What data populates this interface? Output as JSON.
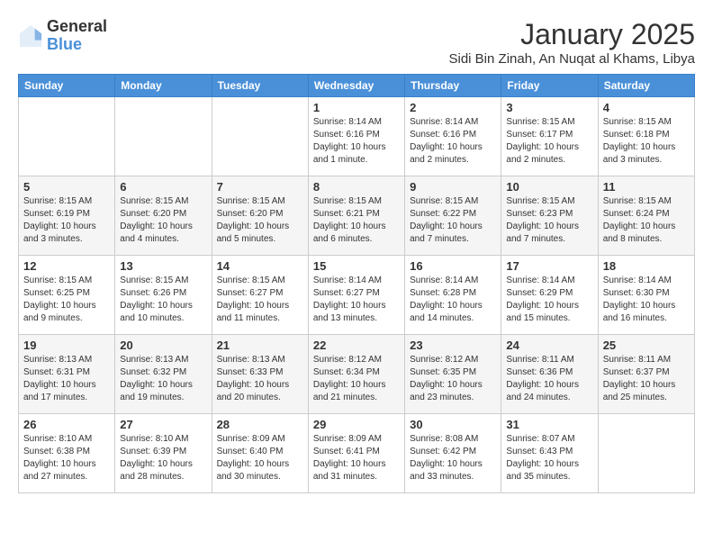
{
  "header": {
    "logo_general": "General",
    "logo_blue": "Blue",
    "month_year": "January 2025",
    "location": "Sidi Bin Zinah, An Nuqat al Khams, Libya"
  },
  "calendar": {
    "days_of_week": [
      "Sunday",
      "Monday",
      "Tuesday",
      "Wednesday",
      "Thursday",
      "Friday",
      "Saturday"
    ],
    "weeks": [
      [
        {
          "day": "",
          "content": ""
        },
        {
          "day": "",
          "content": ""
        },
        {
          "day": "",
          "content": ""
        },
        {
          "day": "1",
          "content": "Sunrise: 8:14 AM\nSunset: 6:16 PM\nDaylight: 10 hours\nand 1 minute."
        },
        {
          "day": "2",
          "content": "Sunrise: 8:14 AM\nSunset: 6:16 PM\nDaylight: 10 hours\nand 2 minutes."
        },
        {
          "day": "3",
          "content": "Sunrise: 8:15 AM\nSunset: 6:17 PM\nDaylight: 10 hours\nand 2 minutes."
        },
        {
          "day": "4",
          "content": "Sunrise: 8:15 AM\nSunset: 6:18 PM\nDaylight: 10 hours\nand 3 minutes."
        }
      ],
      [
        {
          "day": "5",
          "content": "Sunrise: 8:15 AM\nSunset: 6:19 PM\nDaylight: 10 hours\nand 3 minutes."
        },
        {
          "day": "6",
          "content": "Sunrise: 8:15 AM\nSunset: 6:20 PM\nDaylight: 10 hours\nand 4 minutes."
        },
        {
          "day": "7",
          "content": "Sunrise: 8:15 AM\nSunset: 6:20 PM\nDaylight: 10 hours\nand 5 minutes."
        },
        {
          "day": "8",
          "content": "Sunrise: 8:15 AM\nSunset: 6:21 PM\nDaylight: 10 hours\nand 6 minutes."
        },
        {
          "day": "9",
          "content": "Sunrise: 8:15 AM\nSunset: 6:22 PM\nDaylight: 10 hours\nand 7 minutes."
        },
        {
          "day": "10",
          "content": "Sunrise: 8:15 AM\nSunset: 6:23 PM\nDaylight: 10 hours\nand 7 minutes."
        },
        {
          "day": "11",
          "content": "Sunrise: 8:15 AM\nSunset: 6:24 PM\nDaylight: 10 hours\nand 8 minutes."
        }
      ],
      [
        {
          "day": "12",
          "content": "Sunrise: 8:15 AM\nSunset: 6:25 PM\nDaylight: 10 hours\nand 9 minutes."
        },
        {
          "day": "13",
          "content": "Sunrise: 8:15 AM\nSunset: 6:26 PM\nDaylight: 10 hours\nand 10 minutes."
        },
        {
          "day": "14",
          "content": "Sunrise: 8:15 AM\nSunset: 6:27 PM\nDaylight: 10 hours\nand 11 minutes."
        },
        {
          "day": "15",
          "content": "Sunrise: 8:14 AM\nSunset: 6:27 PM\nDaylight: 10 hours\nand 13 minutes."
        },
        {
          "day": "16",
          "content": "Sunrise: 8:14 AM\nSunset: 6:28 PM\nDaylight: 10 hours\nand 14 minutes."
        },
        {
          "day": "17",
          "content": "Sunrise: 8:14 AM\nSunset: 6:29 PM\nDaylight: 10 hours\nand 15 minutes."
        },
        {
          "day": "18",
          "content": "Sunrise: 8:14 AM\nSunset: 6:30 PM\nDaylight: 10 hours\nand 16 minutes."
        }
      ],
      [
        {
          "day": "19",
          "content": "Sunrise: 8:13 AM\nSunset: 6:31 PM\nDaylight: 10 hours\nand 17 minutes."
        },
        {
          "day": "20",
          "content": "Sunrise: 8:13 AM\nSunset: 6:32 PM\nDaylight: 10 hours\nand 19 minutes."
        },
        {
          "day": "21",
          "content": "Sunrise: 8:13 AM\nSunset: 6:33 PM\nDaylight: 10 hours\nand 20 minutes."
        },
        {
          "day": "22",
          "content": "Sunrise: 8:12 AM\nSunset: 6:34 PM\nDaylight: 10 hours\nand 21 minutes."
        },
        {
          "day": "23",
          "content": "Sunrise: 8:12 AM\nSunset: 6:35 PM\nDaylight: 10 hours\nand 23 minutes."
        },
        {
          "day": "24",
          "content": "Sunrise: 8:11 AM\nSunset: 6:36 PM\nDaylight: 10 hours\nand 24 minutes."
        },
        {
          "day": "25",
          "content": "Sunrise: 8:11 AM\nSunset: 6:37 PM\nDaylight: 10 hours\nand 25 minutes."
        }
      ],
      [
        {
          "day": "26",
          "content": "Sunrise: 8:10 AM\nSunset: 6:38 PM\nDaylight: 10 hours\nand 27 minutes."
        },
        {
          "day": "27",
          "content": "Sunrise: 8:10 AM\nSunset: 6:39 PM\nDaylight: 10 hours\nand 28 minutes."
        },
        {
          "day": "28",
          "content": "Sunrise: 8:09 AM\nSunset: 6:40 PM\nDaylight: 10 hours\nand 30 minutes."
        },
        {
          "day": "29",
          "content": "Sunrise: 8:09 AM\nSunset: 6:41 PM\nDaylight: 10 hours\nand 31 minutes."
        },
        {
          "day": "30",
          "content": "Sunrise: 8:08 AM\nSunset: 6:42 PM\nDaylight: 10 hours\nand 33 minutes."
        },
        {
          "day": "31",
          "content": "Sunrise: 8:07 AM\nSunset: 6:43 PM\nDaylight: 10 hours\nand 35 minutes."
        },
        {
          "day": "",
          "content": ""
        }
      ]
    ]
  }
}
